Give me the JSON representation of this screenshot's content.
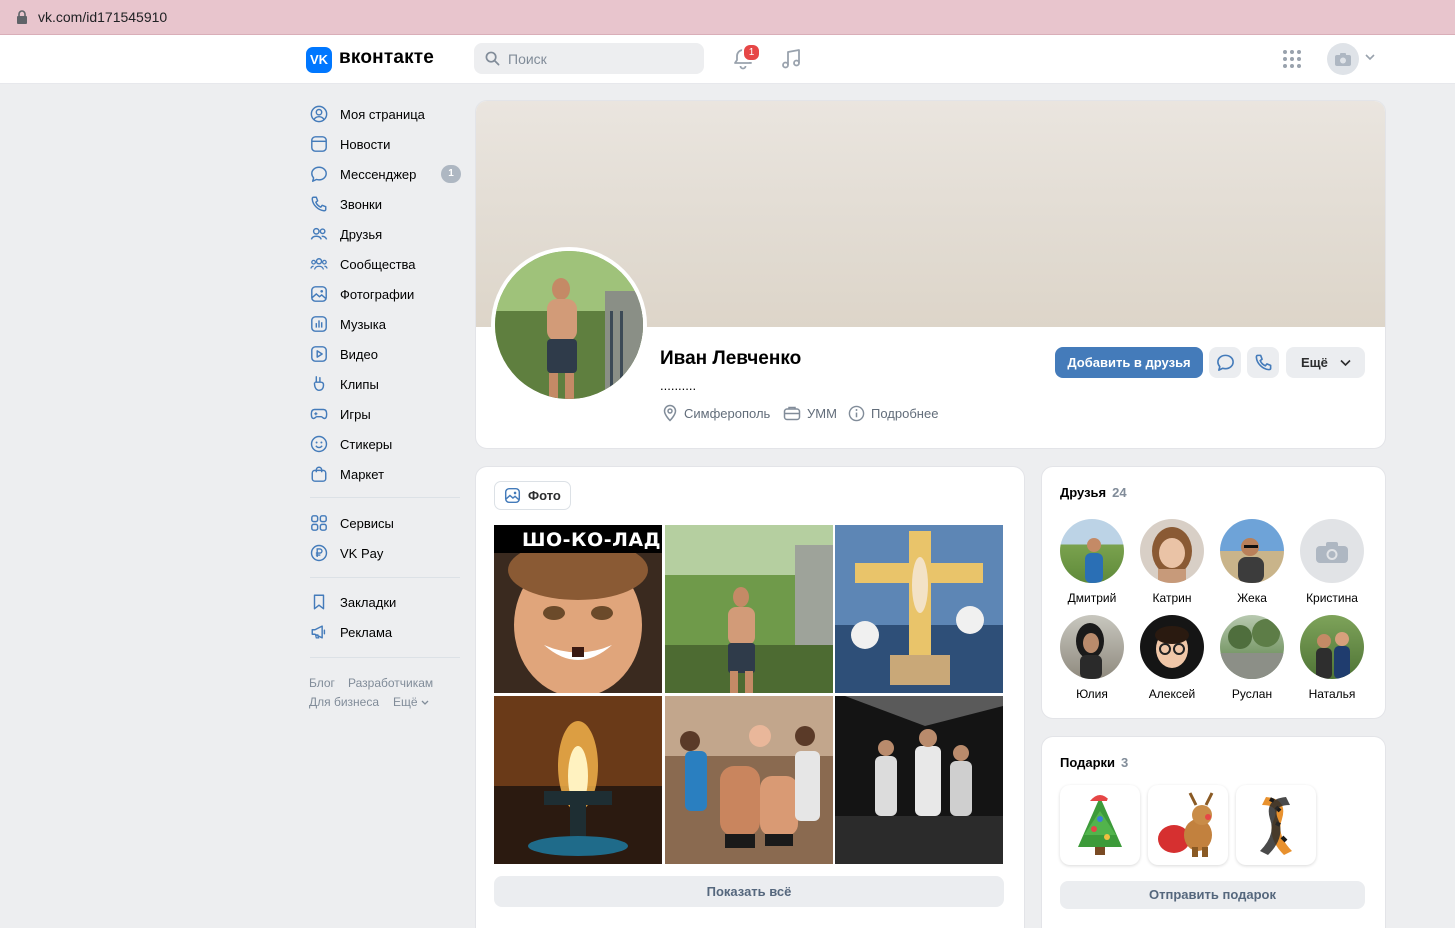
{
  "browser": {
    "url": "vk.com/id171545910"
  },
  "header": {
    "logo_mark": "VK",
    "logo_text": "вконтакте",
    "search_placeholder": "Поиск",
    "notifications_count": "1"
  },
  "sidebar": {
    "items": [
      {
        "label": "Моя страница",
        "icon": "user-circle-icon"
      },
      {
        "label": "Новости",
        "icon": "news-icon"
      },
      {
        "label": "Мессенджер",
        "icon": "message-icon",
        "badge": "1"
      },
      {
        "label": "Звонки",
        "icon": "phone-icon"
      },
      {
        "label": "Друзья",
        "icon": "friends-icon"
      },
      {
        "label": "Сообщества",
        "icon": "communities-icon"
      },
      {
        "label": "Фотографии",
        "icon": "photos-icon"
      },
      {
        "label": "Музыка",
        "icon": "music-icon"
      },
      {
        "label": "Видео",
        "icon": "video-icon"
      },
      {
        "label": "Клипы",
        "icon": "clips-icon"
      },
      {
        "label": "Игры",
        "icon": "games-icon"
      },
      {
        "label": "Стикеры",
        "icon": "stickers-icon"
      },
      {
        "label": "Маркет",
        "icon": "market-icon"
      }
    ],
    "items2": [
      {
        "label": "Сервисы",
        "icon": "services-icon"
      },
      {
        "label": "VK Pay",
        "icon": "vkpay-icon"
      }
    ],
    "items3": [
      {
        "label": "Закладки",
        "icon": "bookmark-icon"
      },
      {
        "label": "Реклама",
        "icon": "ads-icon"
      }
    ],
    "footer": {
      "blog": "Блог",
      "developers": "Разработчикам",
      "business": "Для бизнеса",
      "more": "Ещё"
    }
  },
  "profile": {
    "name": "Иван Левченко",
    "status": "..........",
    "city": "Симферополь",
    "work": "УММ",
    "details": "Подробнее",
    "add_friend": "Добавить в друзья",
    "more": "Ещё"
  },
  "photos": {
    "tab_label": "Фото",
    "first_photo_caption": "ШО-КО-ЛАД",
    "show_all": "Показать всё"
  },
  "friends": {
    "title": "Друзья",
    "count": "24",
    "list": [
      "Дмитрий",
      "Катрин",
      "Жека",
      "Кристина",
      "Юлия",
      "Алексей",
      "Руслан",
      "Наталья"
    ]
  },
  "gifts": {
    "title": "Подарки",
    "count": "3",
    "send": "Отправить подарок"
  },
  "colors": {
    "accent": "#447bba",
    "brand": "#0077ff",
    "badge": "#e64646"
  }
}
